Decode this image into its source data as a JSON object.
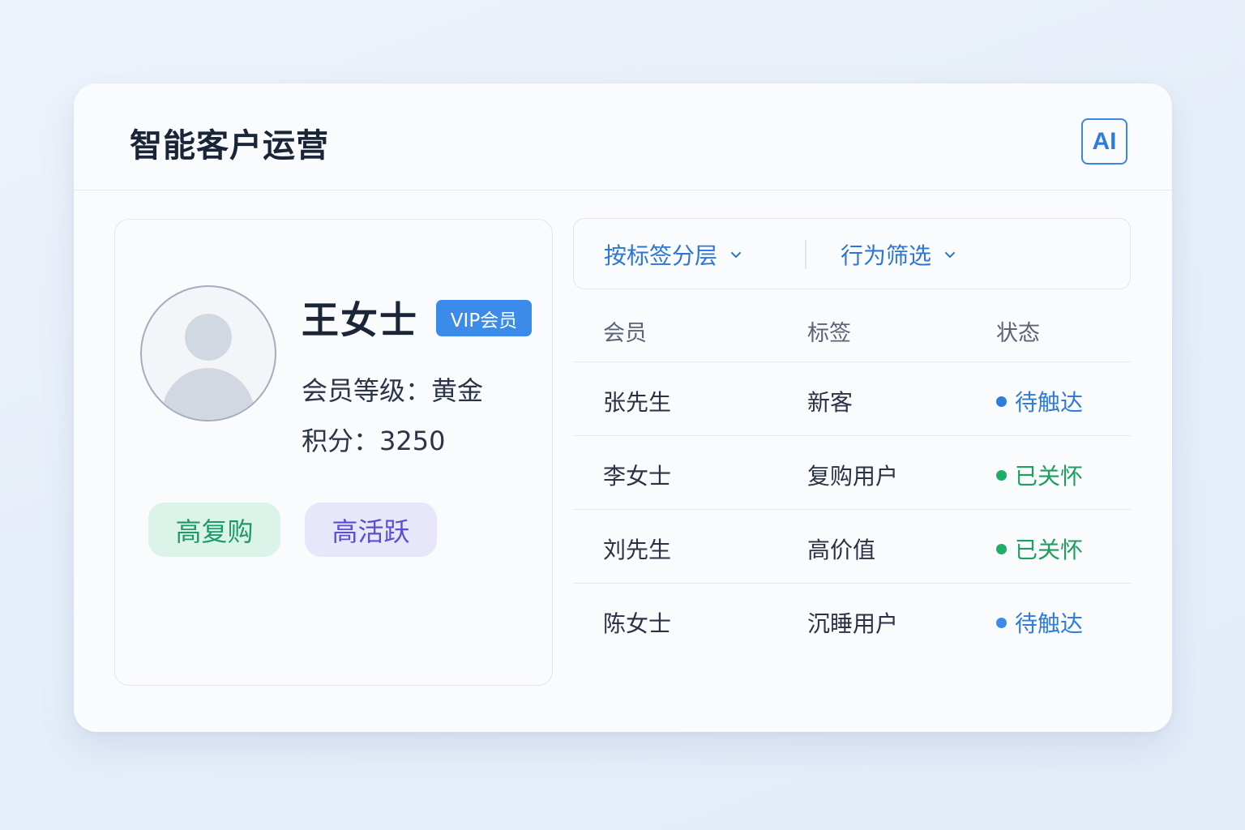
{
  "header": {
    "title": "智能客户运营",
    "ai_badge": "AI"
  },
  "profile": {
    "name": "王女士",
    "vip_badge": "VIP会员",
    "level": "会员等级：黄金",
    "points": "积分：3250",
    "tags": [
      {
        "label": "高复购",
        "color": "#1e9a6a"
      },
      {
        "label": "高活跃",
        "color": "#5b4fcf"
      }
    ]
  },
  "filters": [
    {
      "label": "按标签分层",
      "icon": "chevron-down-icon"
    },
    {
      "label": "行为筛选",
      "icon": "chevron-down-icon"
    }
  ],
  "table": {
    "columns": [
      "会员",
      "标签",
      "状态"
    ],
    "rows": [
      {
        "member": "张先生",
        "tag": "新客",
        "status": "待触达",
        "status_color": "#2f7ce0"
      },
      {
        "member": "李女士",
        "tag": "复购用户",
        "status": "已关怀",
        "status_color": "#1f9e5f"
      },
      {
        "member": "刘先生",
        "tag": "高价值",
        "status": "已关怀",
        "status_color": "#1f9e5f"
      },
      {
        "member": "陈女士",
        "tag": "沉睡用户",
        "status": "待触达",
        "status_color": "#2f7ce0"
      }
    ]
  },
  "colors": {
    "accent": "#3b8beb",
    "pending": "#2f7ce0",
    "done": "#1f9e5f"
  }
}
